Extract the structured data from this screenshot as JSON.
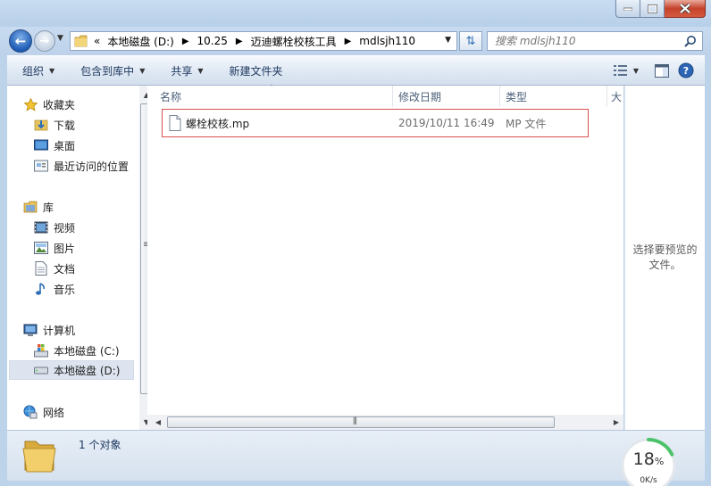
{
  "window": {
    "controls": {
      "minimize": "minimize",
      "maximize": "maximize",
      "close": "close"
    }
  },
  "address": {
    "breadcrumbs": [
      "本地磁盘 (D:)",
      "10.25",
      "迈迪螺栓校核工具",
      "mdlsjh110"
    ],
    "overflow": "«"
  },
  "search": {
    "placeholder": "搜索 mdlsjh110"
  },
  "toolbar": {
    "organize": "组织",
    "include_in_library": "包含到库中",
    "share": "共享",
    "new_folder": "新建文件夹"
  },
  "nav": {
    "favorites": "收藏夹",
    "downloads": "下载",
    "desktop": "桌面",
    "recent": "最近访问的位置",
    "libraries": "库",
    "videos": "视频",
    "pictures": "图片",
    "documents": "文档",
    "music": "音乐",
    "computer": "计算机",
    "drive_c": "本地磁盘 (C:)",
    "drive_d": "本地磁盘 (D:)",
    "network": "网络"
  },
  "columns": {
    "name": "名称",
    "date": "修改日期",
    "type": "类型",
    "size": "大"
  },
  "files": [
    {
      "name": "螺栓校核.mp",
      "date": "2019/10/11 16:49",
      "type": "MP 文件"
    }
  ],
  "preview": {
    "text": "选择要预览的文件。"
  },
  "status": {
    "count": "1 个对象"
  },
  "gauge": {
    "percent": "18",
    "percent_sign": "%",
    "speed": "0K/s",
    "fraction": 0.18
  },
  "colors": {
    "selection_border": "#d9534f",
    "gauge_ring": "#4cc36b"
  }
}
